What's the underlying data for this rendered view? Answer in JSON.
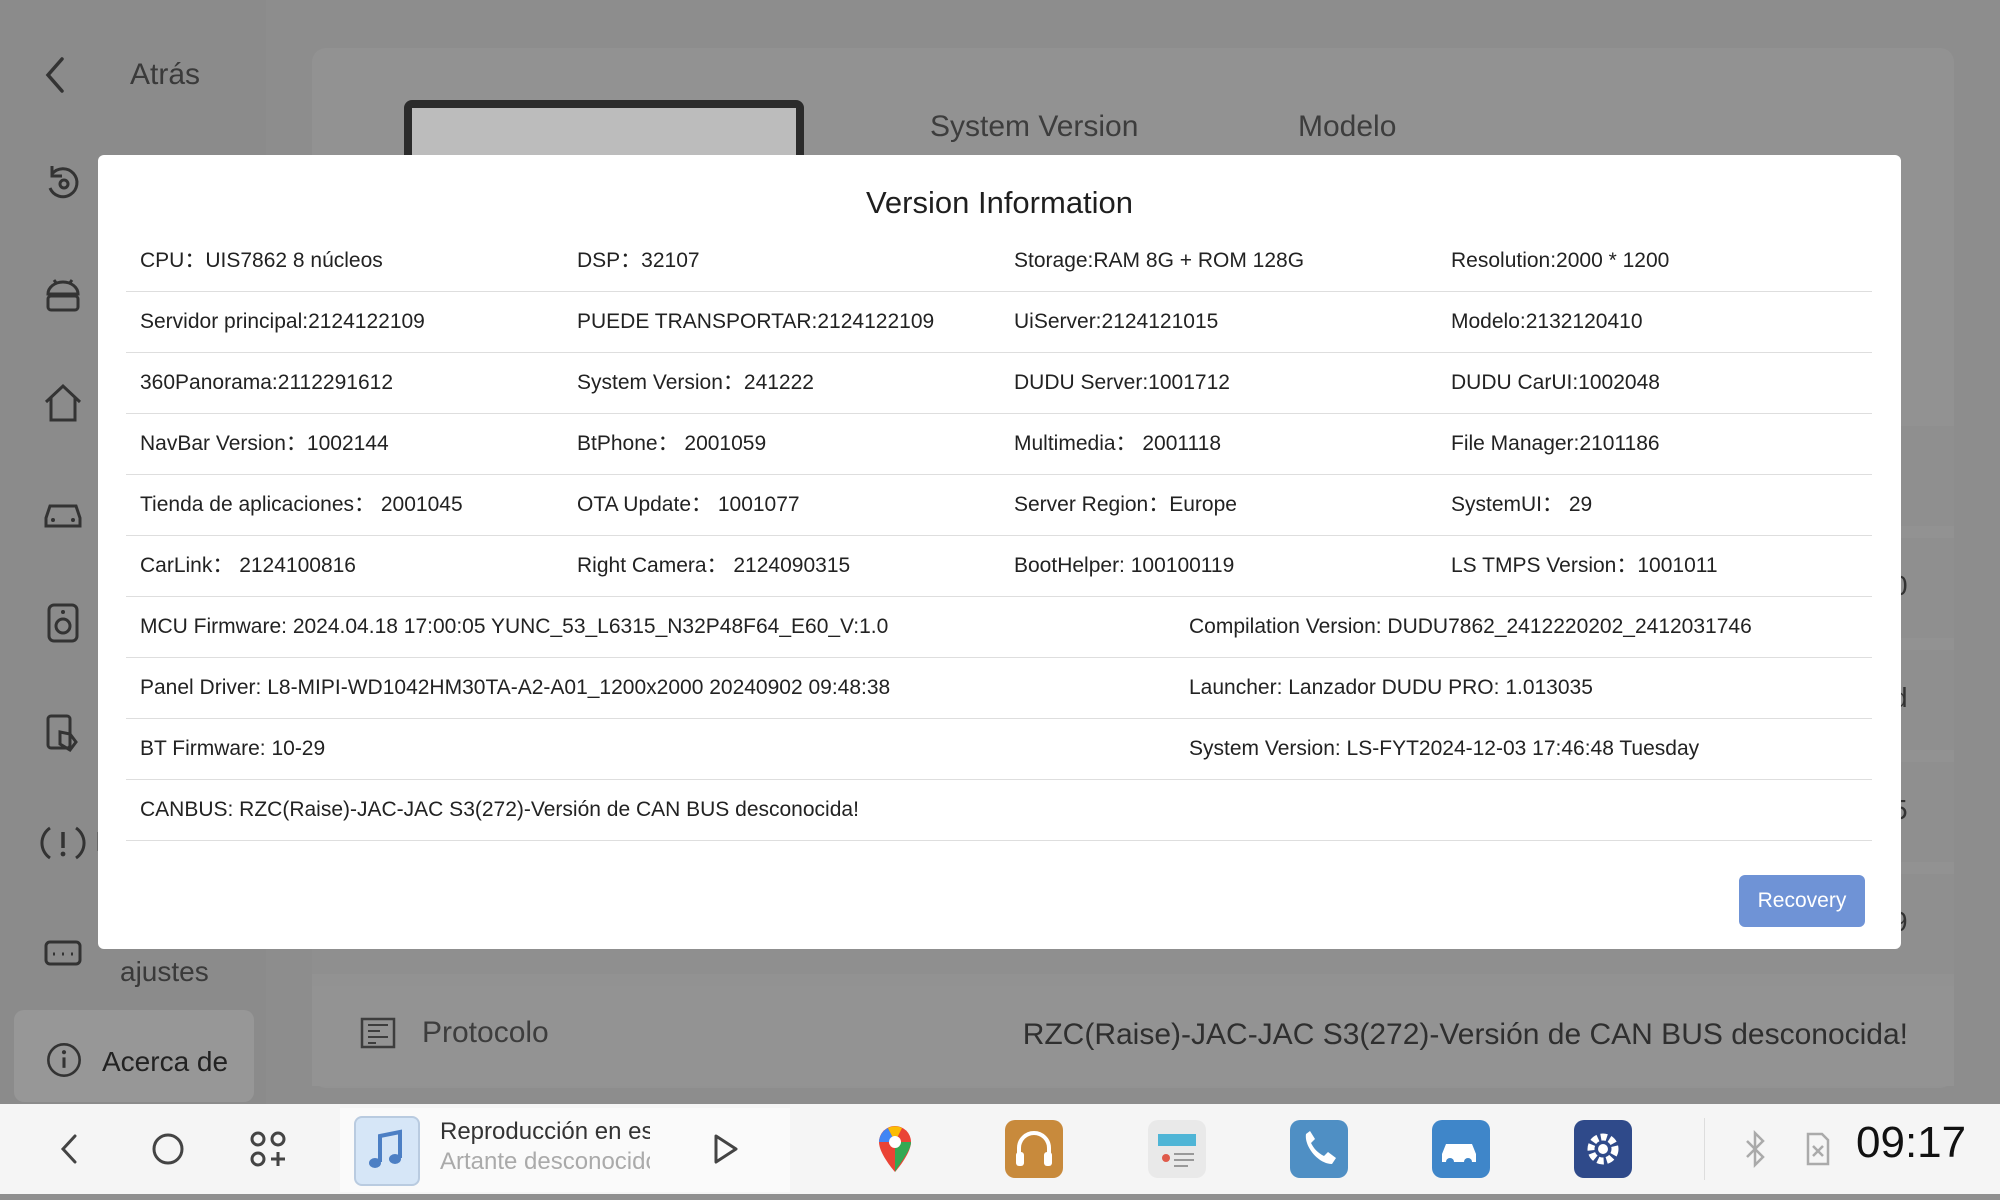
{
  "sidebar": {
    "back_label": "Atrás",
    "partial_settings_label": "ajustes",
    "selected_label": "Acerca de"
  },
  "background": {
    "header_system_version": "System Version",
    "header_modelo": "Modelo",
    "protocol_label": "Protocolo",
    "protocol_value": "RZC(Raise)-JAC-JAC S3(272)-Versión de CAN BUS desconocida!",
    "edge_glyphs": [
      ")",
      "0",
      "d",
      "5",
      "9"
    ]
  },
  "dialog": {
    "title": "Version Information",
    "grid_rows": [
      [
        "CPU：UIS7862 8 núcleos",
        "DSP：32107",
        "Storage:RAM 8G + ROM 128G",
        "Resolution:2000 * 1200"
      ],
      [
        "Servidor principal:2124122109",
        "PUEDE TRANSPORTAR:2124122109",
        "UiServer:2124121015",
        "Modelo:2132120410"
      ],
      [
        "360Panorama:2112291612",
        "System Version：241222",
        "DUDU Server:1001712",
        "DUDU CarUI:1002048"
      ],
      [
        "NavBar Version：1002144",
        "BtPhone：  2001059",
        "Multimedia：  2001118",
        "File Manager:2101186"
      ],
      [
        "Tienda de aplicaciones：  2001045",
        "OTA Update：  1001077",
        "Server Region：Europe",
        "SystemUI：  29"
      ],
      [
        "CarLink：  2124100816",
        "Right Camera：  2124090315",
        "BootHelper: 100100119",
        "LS TMPS Version：1001011"
      ]
    ],
    "half_rows": [
      [
        "MCU Firmware:   2024.04.18 17:00:05 YUNC_53_L6315_N32P48F64_E60_V:1.0",
        "Compilation Version:   DUDU7862_2412220202_2412031746"
      ],
      [
        "Panel Driver:   L8-MIPI-WD1042HM30TA-A2-A01_1200x2000 20240902 09:48:38",
        "Launcher:   Lanzador DUDU PRO: 1.013035"
      ],
      [
        "BT Firmware:   10-29",
        "System Version:   LS-FYT2024-12-03 17:46:48 Tuesday"
      ]
    ],
    "canbus_row": "CANBUS:   RZC(Raise)-JAC-JAC S3(272)-Versión de CAN BUS desconocida!",
    "recovery_button": "Recovery"
  },
  "taskbar": {
    "media_title": "Reproducción en es",
    "media_subtitle": "Artante desconocido",
    "clock": "09:17"
  },
  "colors": {
    "accent": "#6f93d6",
    "overlay": "#8d8d8d"
  }
}
